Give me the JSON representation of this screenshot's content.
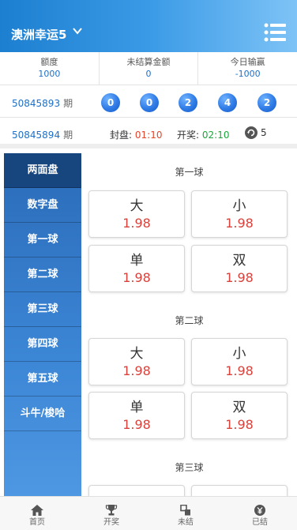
{
  "header": {
    "title": "澳洲幸运5"
  },
  "stats": [
    {
      "label": "额度",
      "value": "1000"
    },
    {
      "label": "未结算金额",
      "value": "0"
    },
    {
      "label": "今日输赢",
      "value": "-1000"
    }
  ],
  "last_draw": {
    "issue": "50845893",
    "suffix": "期",
    "balls": [
      "0",
      "0",
      "2",
      "4",
      "2"
    ]
  },
  "next_draw": {
    "issue": "50845894",
    "suffix": "期",
    "close_label": "封盘:",
    "close_time": "01:10",
    "open_label": "开奖:",
    "open_time": "02:10",
    "count": "5"
  },
  "sidebar": {
    "items": [
      "两面盘",
      "数字盘",
      "第一球",
      "第二球",
      "第三球",
      "第四球",
      "第五球",
      "斗牛/梭哈"
    ]
  },
  "sections": [
    {
      "title": "第一球",
      "options": [
        {
          "name": "大",
          "odds": "1.98"
        },
        {
          "name": "小",
          "odds": "1.98"
        },
        {
          "name": "单",
          "odds": "1.98"
        },
        {
          "name": "双",
          "odds": "1.98"
        }
      ]
    },
    {
      "title": "第二球",
      "options": [
        {
          "name": "大",
          "odds": "1.98"
        },
        {
          "name": "小",
          "odds": "1.98"
        },
        {
          "name": "单",
          "odds": "1.98"
        },
        {
          "name": "双",
          "odds": "1.98"
        }
      ]
    },
    {
      "title": "第三球"
    }
  ],
  "tabbar": {
    "items": [
      "首页",
      "开奖",
      "未结",
      "已结"
    ]
  }
}
